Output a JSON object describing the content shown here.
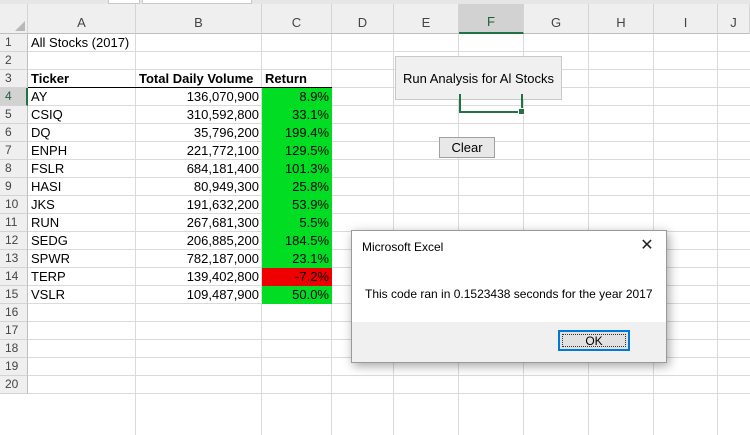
{
  "columns": [
    "A",
    "B",
    "C",
    "D",
    "E",
    "F",
    "G",
    "H",
    "I",
    "J"
  ],
  "rows": [
    "1",
    "2",
    "3",
    "4",
    "5",
    "6",
    "7",
    "8",
    "9",
    "10",
    "11",
    "12",
    "13",
    "14",
    "15",
    "16",
    "17",
    "18",
    "19",
    "20"
  ],
  "sheet": {
    "title": "All Stocks (2017)",
    "headers": {
      "ticker": "Ticker",
      "volume": "Total Daily Volume",
      "return": "Return"
    },
    "data": [
      {
        "ticker": "AY",
        "volume": "136,070,900",
        "return": "8.9%"
      },
      {
        "ticker": "CSIQ",
        "volume": "310,592,800",
        "return": "33.1%"
      },
      {
        "ticker": "DQ",
        "volume": "35,796,200",
        "return": "199.4%"
      },
      {
        "ticker": "ENPH",
        "volume": "221,772,100",
        "return": "129.5%"
      },
      {
        "ticker": "FSLR",
        "volume": "684,181,400",
        "return": "101.3%"
      },
      {
        "ticker": "HASI",
        "volume": "80,949,300",
        "return": "25.8%"
      },
      {
        "ticker": "JKS",
        "volume": "191,632,200",
        "return": "53.9%"
      },
      {
        "ticker": "RUN",
        "volume": "267,681,300",
        "return": "5.5%"
      },
      {
        "ticker": "SEDG",
        "volume": "206,885,200",
        "return": "184.5%"
      },
      {
        "ticker": "SPWR",
        "volume": "782,187,000",
        "return": "23.1%"
      },
      {
        "ticker": "TERP",
        "volume": "139,402,800",
        "return": "-7.2%"
      },
      {
        "ticker": "VSLR",
        "volume": "109,487,900",
        "return": "50.0%"
      }
    ]
  },
  "buttons": {
    "run_analysis": "Run Analysis for Al Stocks",
    "clear": "Clear"
  },
  "dialog": {
    "title": "Microsoft Excel",
    "message": "This code ran in 0.1523438 seconds for the year 2017",
    "ok": "OK",
    "close_icon": "close-icon"
  },
  "colors": {
    "positive": "#00dd22",
    "negative": "#ee0000",
    "excel_green": "#217346",
    "focus_blue": "#0078d7"
  },
  "selection": {
    "column": "F",
    "row": "4"
  }
}
